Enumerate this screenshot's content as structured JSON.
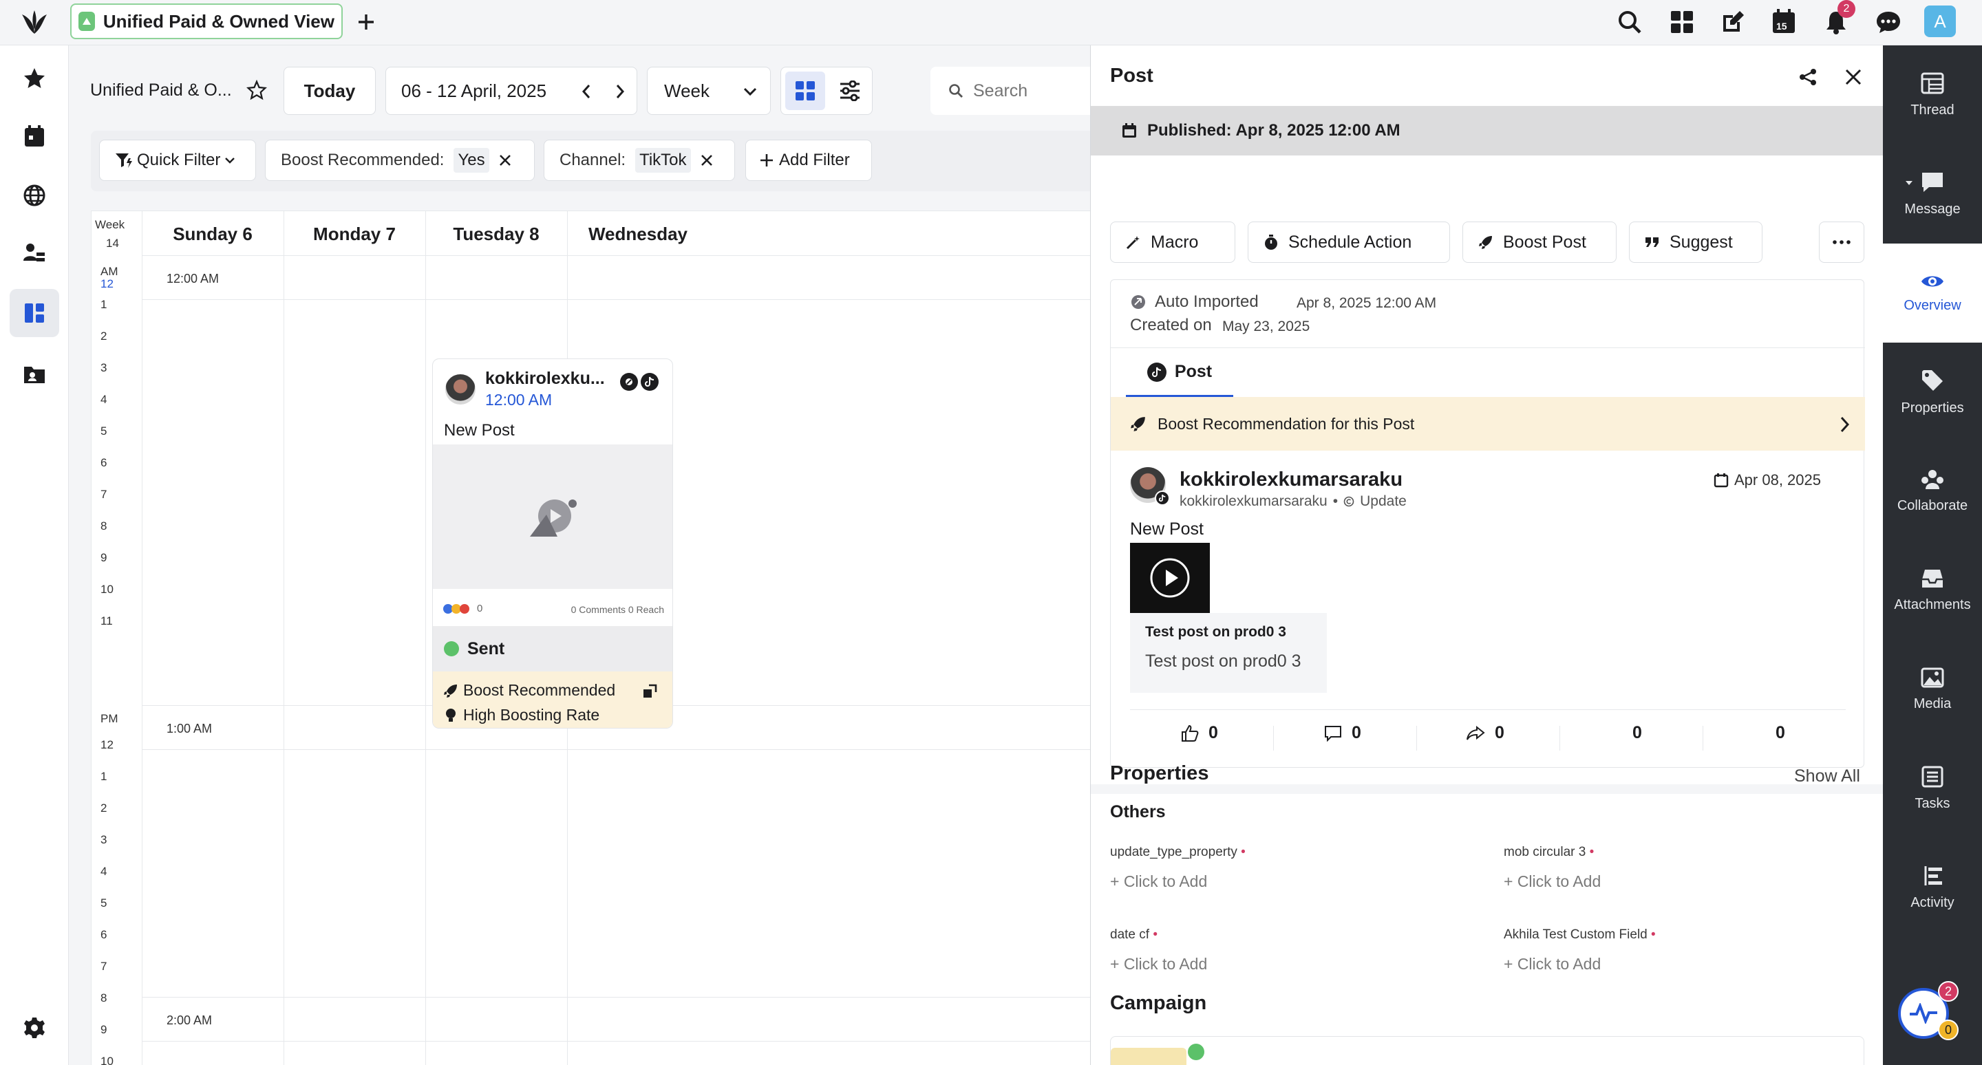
{
  "topbar": {
    "tab_title": "Unified Paid & Owned View",
    "notification_count": "2",
    "calendar_day": "15",
    "avatar_initial": "A"
  },
  "toolbar": {
    "view_name": "Unified Paid & O...",
    "today_label": "Today",
    "date_range": "06 - 12 April, 2025",
    "period_select": "Week",
    "search_placeholder": "Search"
  },
  "filters": {
    "quick_filter": "Quick Filter",
    "boost_label": "Boost Recommended:",
    "boost_value": "Yes",
    "channel_label": "Channel:",
    "channel_value": "TikTok",
    "add_filter": "Add Filter"
  },
  "calendar": {
    "week_label": "Week",
    "week_number": "14",
    "days": [
      "Sunday 6",
      "Monday 7",
      "Tuesday 8",
      "Wednesday"
    ],
    "hour_labels": [
      "12:00 AM",
      "1:00 AM",
      "2:00 AM"
    ],
    "am_label": "AM",
    "pm_label": "PM",
    "minute_ticks": [
      "12",
      "1",
      "2",
      "3",
      "4",
      "5",
      "6",
      "7",
      "8",
      "9",
      "10",
      "11",
      "12",
      "1",
      "2",
      "3",
      "4",
      "5",
      "6",
      "7",
      "8",
      "9",
      "10",
      "11"
    ]
  },
  "calendar_post": {
    "author": "kokkirolexku...",
    "time": "12:00 AM",
    "text": "New Post",
    "reactions": "0",
    "stats": "0 Comments 0 Reach",
    "status": "Sent",
    "boost_label": "Boost Recommended",
    "boost_rate": "High Boosting Rate"
  },
  "panel": {
    "title": "Post",
    "published": "Published: Apr 8, 2025 12:00 AM",
    "actions": {
      "macro": "Macro",
      "schedule": "Schedule Action",
      "boost": "Boost Post",
      "suggest": "Suggest"
    },
    "meta": {
      "source": "Auto Imported",
      "source_date": "Apr 8, 2025 12:00 AM",
      "created_label": "Created on",
      "created_date": "May 23, 2025"
    },
    "tab_post": "Post",
    "boost_banner": "Boost Recommendation for this Post",
    "post": {
      "author": "kokkirolexkumarsaraku",
      "handle": "kokkirolexkumarsaraku",
      "sep": "•",
      "update_label": "Update",
      "date": "Apr 08, 2025",
      "text": "New Post",
      "caption_title": "Test post on prod0 3",
      "caption_body": "Test post on prod0 3"
    },
    "stats": {
      "likes": "0",
      "comments": "0",
      "shares": "0",
      "stat4": "0",
      "stat5": "0"
    },
    "properties": {
      "title": "Properties",
      "show_all": "Show All",
      "group": "Others",
      "fields": [
        {
          "label": "update_type_property",
          "value": "+ Click to Add"
        },
        {
          "label": "mob circular 3",
          "value": "+ Click to Add"
        },
        {
          "label": "date cf",
          "value": "+ Click to Add"
        },
        {
          "label": "Akhila Test Custom Field",
          "value": "+ Click to Add"
        }
      ],
      "campaign": "Campaign"
    }
  },
  "right_rail": {
    "items": [
      "Thread",
      "Message",
      "Overview",
      "Properties",
      "Collaborate",
      "Attachments",
      "Media",
      "Tasks",
      "Activity"
    ],
    "badge_top": "2",
    "badge_bottom": "0"
  },
  "colors": {
    "accent": "#2557d6",
    "sent": "#5cc169",
    "boost_bg": "#fbf1da",
    "rail_dark": "#2b2e33"
  }
}
